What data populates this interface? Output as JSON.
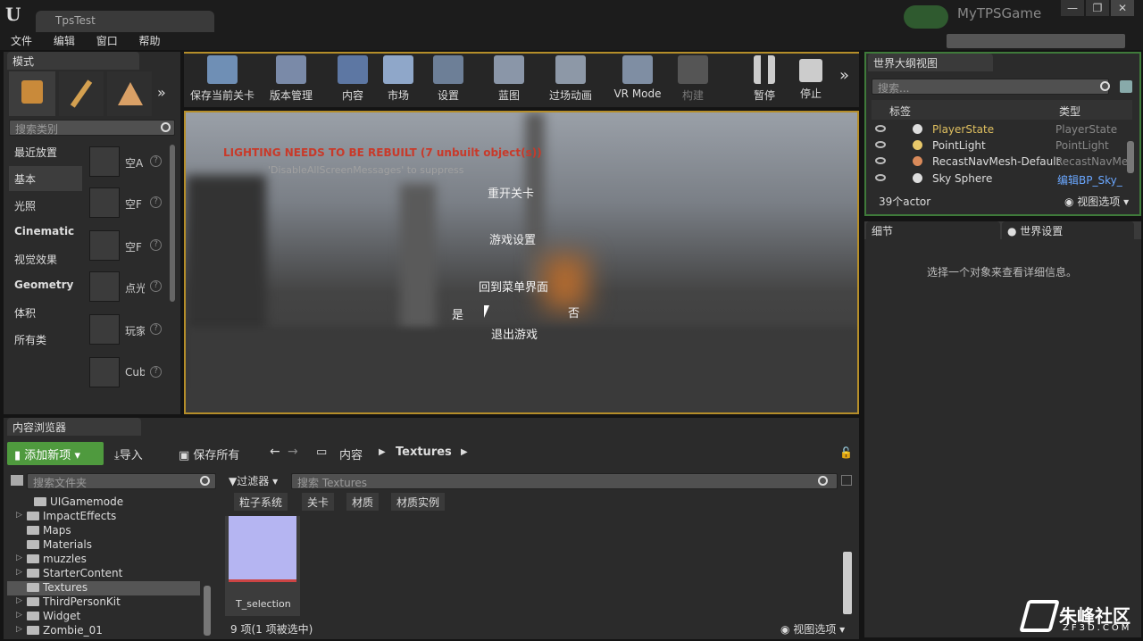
{
  "window": {
    "doc_tab": "TpsTest",
    "project": "MyTPSGame",
    "min": "—",
    "max": "❐",
    "close": "✕"
  },
  "menu": [
    "文件",
    "编辑",
    "窗口",
    "帮助"
  ],
  "modes": {
    "tab": "模式",
    "search_placeholder": "搜索类别",
    "categories": [
      "最近放置",
      "基本",
      "光照",
      "Cinematic",
      "视觉效果",
      "Geometry",
      "体积",
      "所有类"
    ],
    "items": [
      "空A",
      "空F",
      "空F",
      "点光",
      "玩家",
      "Cub"
    ],
    "more": "»"
  },
  "toolbar": [
    {
      "label": "保存当前关卡",
      "icon": "save-icon"
    },
    {
      "label": "版本管理",
      "icon": "source-control-icon"
    },
    {
      "label": "内容",
      "icon": "content-icon"
    },
    {
      "label": "市场",
      "icon": "marketplace-icon"
    },
    {
      "label": "设置",
      "icon": "settings-icon"
    },
    {
      "label": "蓝图",
      "icon": "blueprint-icon"
    },
    {
      "label": "过场动画",
      "icon": "cinematics-icon"
    },
    {
      "label": "VR Mode",
      "icon": "vr-icon"
    },
    {
      "label": "构建",
      "icon": "build-icon"
    },
    {
      "label": "暂停",
      "icon": "pause-icon"
    },
    {
      "label": "停止",
      "icon": "stop-icon"
    }
  ],
  "viewport": {
    "warning": "LIGHTING NEEDS TO BE REBUILT (7 unbuilt object(s))",
    "suppress": "'DisableAllScreenMessages' to suppress",
    "menu": {
      "restart": "重开关卡",
      "settings": "游戏设置",
      "back": "回到菜单界面",
      "yes": "是",
      "no": "否",
      "quit": "退出游戏"
    }
  },
  "outliner": {
    "tab": "世界大纲视图",
    "search_placeholder": "搜索...",
    "col_label": "标签",
    "col_type": "类型",
    "rows": [
      {
        "name": "PlayerState",
        "type": "PlayerState"
      },
      {
        "name": "PointLight",
        "type": "PointLight"
      },
      {
        "name": "RecastNavMesh-Default",
        "type": "RecastNavMe"
      },
      {
        "name": "Sky Sphere",
        "type": "编辑BP_Sky_"
      }
    ],
    "count": "39个actor",
    "view_options": "视图选项"
  },
  "details": {
    "tab": "细节",
    "world_tab": "世界设置",
    "hint": "选择一个对象来查看详细信息。"
  },
  "content": {
    "tab": "内容浏览器",
    "add_new": "添加新项",
    "import": "导入",
    "save_all": "保存所有",
    "path": [
      "内容",
      "Textures"
    ],
    "folder_search": "搜索文件夹",
    "filters": "过滤器",
    "asset_search": "搜索 Textures",
    "chips": [
      "粒子系统",
      "关卡",
      "材质",
      "材质实例"
    ],
    "folders": [
      {
        "name": "UIGamemode",
        "expand": false
      },
      {
        "name": "ImpactEffects",
        "expand": true
      },
      {
        "name": "Maps",
        "expand": false
      },
      {
        "name": "Materials",
        "expand": false
      },
      {
        "name": "muzzles",
        "expand": true
      },
      {
        "name": "StarterContent",
        "expand": true
      },
      {
        "name": "Textures",
        "expand": false
      },
      {
        "name": "ThirdPersonKit",
        "expand": true
      },
      {
        "name": "Widget",
        "expand": true
      },
      {
        "name": "Zombie_01",
        "expand": true
      }
    ],
    "asset": "T_selection",
    "status": "9 项(1 项被选中)",
    "view_options": "视图选项"
  },
  "watermark": {
    "text": "朱峰社区",
    "sub": "ZF3D.COM"
  },
  "colors": {
    "accent": "#b58e2a",
    "green": "#4f9a3e",
    "outline_border": "#3f7a3a",
    "link": "#6aa7ff"
  }
}
